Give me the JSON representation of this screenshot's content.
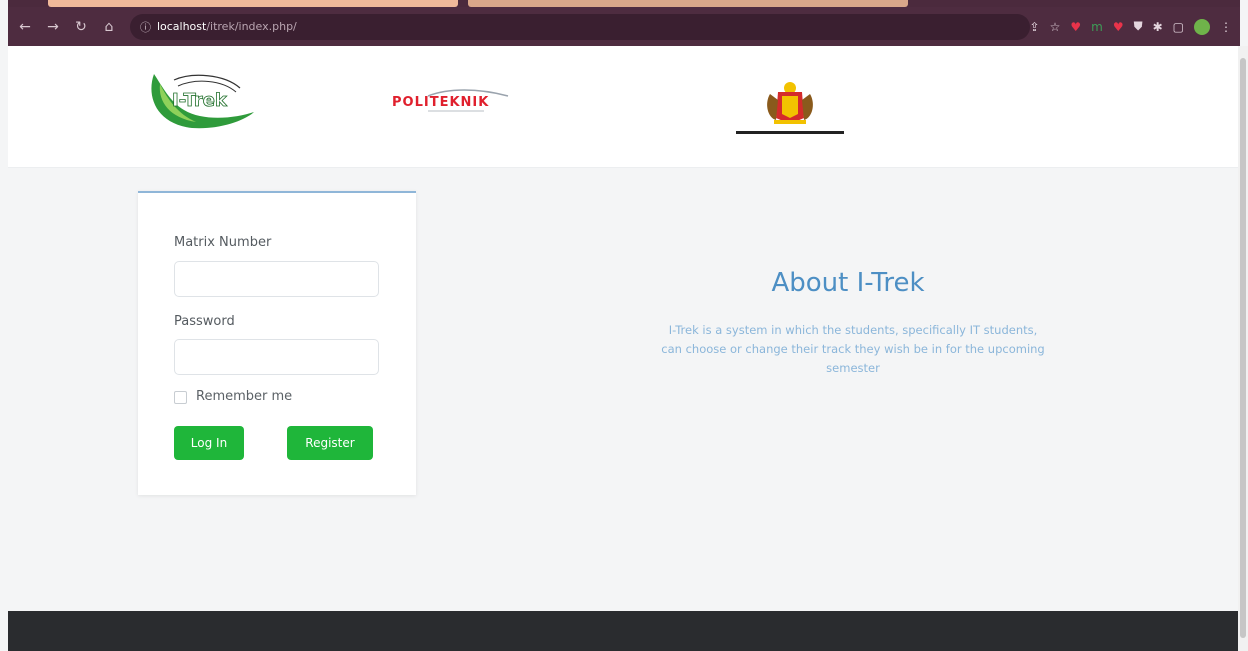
{
  "browser": {
    "url_host": "localhost",
    "url_path": "/itrek/index.php/",
    "colors": {
      "chrome": "#4b2a3d",
      "tab_active": "#f0b99a"
    }
  },
  "login": {
    "matrix_label": "Matrix Number",
    "matrix_value": "",
    "password_label": "Password",
    "password_value": "",
    "remember_label": "Remember me",
    "login_button": "Log In",
    "register_button": "Register",
    "button_color": "#1fb63a"
  },
  "about": {
    "title": "About I-Trek",
    "text": "I-Trek is a system in which the students, specifically IT students, can choose or change their track they wish be in for the upcoming semester",
    "title_color": "#4d8fc4"
  },
  "logos": {
    "itrek": "I-Trek",
    "politeknik": "POLITEKNIK"
  }
}
